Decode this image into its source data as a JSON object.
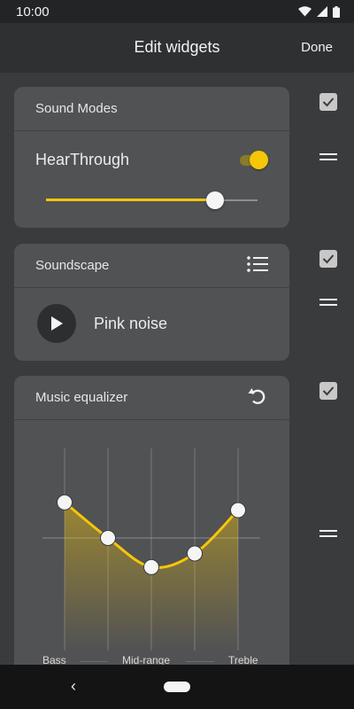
{
  "status_bar": {
    "time": "10:00",
    "icons": [
      "wifi-icon",
      "signal-icon",
      "battery-icon"
    ]
  },
  "header": {
    "title": "Edit widgets",
    "done_label": "Done"
  },
  "sound_modes": {
    "title": "Sound Modes",
    "hear_through_label": "HearThrough",
    "hear_through_on": true,
    "level": 0.8
  },
  "soundscape": {
    "title": "Soundscape",
    "action_icon": "list-icon",
    "play_icon": "play-icon",
    "track": "Pink noise"
  },
  "equalizer": {
    "title": "Music equalizer",
    "action_icon": "reset-icon",
    "band_levels": [
      0.55,
      0,
      -0.45,
      -0.24,
      0.43
    ],
    "labels": {
      "bass": "Bass",
      "mid": "Mid-range",
      "treble": "Treble"
    }
  },
  "side_controls": [
    {
      "checked": true,
      "drag_icon": "drag-handle-icon"
    },
    {
      "checked": true,
      "drag_icon": "drag-handle-icon"
    },
    {
      "checked": true,
      "drag_icon": "drag-handle-icon"
    }
  ],
  "colors": {
    "accent": "#f6c609",
    "card": "#515254",
    "background": "#3a3b3d"
  }
}
